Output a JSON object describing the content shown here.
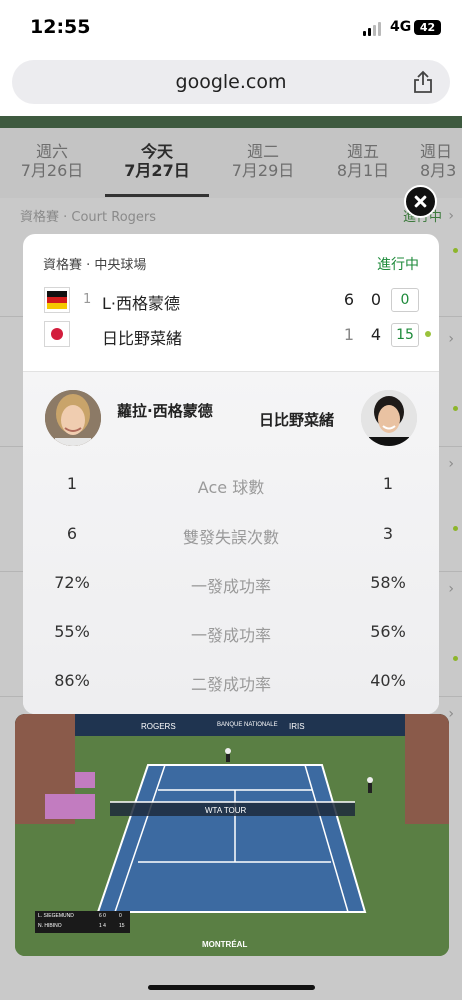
{
  "status_bar": {
    "time": "12:55",
    "network": "4G",
    "battery": "42"
  },
  "browser": {
    "url": "google.com"
  },
  "date_tabs": [
    {
      "weekday": "週六",
      "date": "7月26日"
    },
    {
      "weekday": "今天",
      "date": "7月27日"
    },
    {
      "weekday": "週二",
      "date": "7月29日"
    },
    {
      "weekday": "週五",
      "date": "8月1日"
    },
    {
      "weekday": "週日",
      "date": "8月3"
    }
  ],
  "background_section": {
    "label": "資格賽 · Court Rogers",
    "status_partial": "進行中"
  },
  "match_card": {
    "label": "資格賽 · 中央球場",
    "status": "進行中",
    "players": [
      {
        "flag": "germany-flag",
        "seed": "1",
        "name": "L·西格蒙德",
        "sets": [
          "6",
          "0"
        ],
        "points": "0"
      },
      {
        "flag": "japan-flag",
        "seed": "",
        "name": "日比野菜緒",
        "sets": [
          "1",
          "4"
        ],
        "points": "15"
      }
    ],
    "stats_header": {
      "player1_full_name": "蘿拉·西格蒙德",
      "player2_full_name": "日比野菜緒"
    },
    "stats": [
      {
        "p1": "1",
        "label": "Ace 球數",
        "p2": "1"
      },
      {
        "p1": "6",
        "label": "雙發失誤次數",
        "p2": "3"
      },
      {
        "p1": "72%",
        "label": "一發成功率",
        "p2": "58%"
      },
      {
        "p1": "55%",
        "label": "一發成功率",
        "p2": "56%"
      },
      {
        "p1": "86%",
        "label": "二發成功率",
        "p2": "40%"
      }
    ]
  },
  "video": {
    "scoreboard": [
      {
        "name": "L. SIEGEMUND",
        "sets": "6 0",
        "points": "0"
      },
      {
        "name": "N. HIBINO",
        "sets": "1 4",
        "points": "15"
      }
    ],
    "board_texts": {
      "sponsor1": "ROGERS",
      "sponsor2": "BANQUE NATIONALE",
      "sponsor3": "IRIS",
      "net_text": "WTA TOUR",
      "court_text": "MONTRÉAL"
    }
  },
  "colors": {
    "live_green": "#1d8a3a",
    "serve_dot": "#9ac23b",
    "court_blue": "#3b6aa0",
    "court_green": "#587d42"
  }
}
